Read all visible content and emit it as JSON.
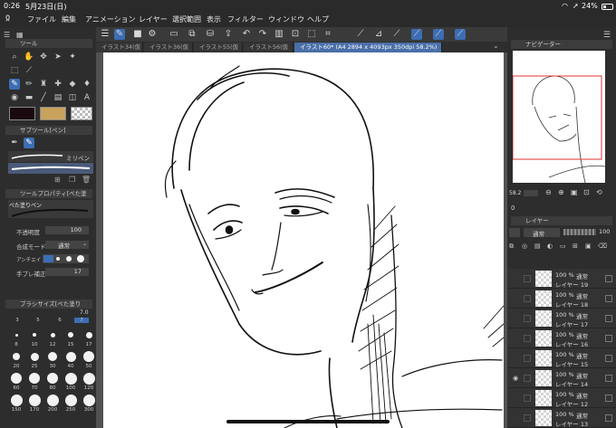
{
  "status": {
    "time": "0:26",
    "date": "5月23日(日)",
    "battery": "24%"
  },
  "menu": {
    "items": [
      "ファイル",
      "編集",
      "アニメーション",
      "レイヤー",
      "選択範囲",
      "表示",
      "フィルター",
      "ウィンドウ",
      "ヘルプ"
    ]
  },
  "tabs": [
    {
      "label": "イラスト34(仮"
    },
    {
      "label": "イラスト36(仮"
    },
    {
      "label": "イラスト55(仮"
    },
    {
      "label": "イラスト56(仮"
    },
    {
      "label": "イラスト60* (A4 2894 x 4093px 350dpi 58.2%)"
    }
  ],
  "left": {
    "tool_panel_title": "ツール",
    "subtool_panel_title": "サブツール[ペン]",
    "subtool_item": "ミリペン",
    "tool_property_title": "ツールプロパティ[べた塗",
    "brush_name": "べた塗りペン",
    "opacity_label": "不透明度",
    "opacity_value": "100",
    "blend_label": "合成モード",
    "blend_value": "通常",
    "antialias_label": "アンチエイ",
    "stabilize_label": "手ブレ補正",
    "stabilize_value": "17",
    "brushsize_panel_title": "ブラシサイズ[べた塗り",
    "brushsize_top": [
      "3",
      "5",
      "6",
      "7"
    ],
    "brushsize_current": "7.0",
    "brush_sizes": [
      "8",
      "10",
      "12",
      "15",
      "17",
      "20",
      "25",
      "30",
      "40",
      "50",
      "60",
      "70",
      "80",
      "100",
      "120",
      "150",
      "170",
      "200",
      "250",
      "300"
    ]
  },
  "right": {
    "navigator_title": "ナビゲーター",
    "zoom_value": "58.2",
    "layer_panel_title": "レイヤー",
    "layer_blend": "通常",
    "layer_opacity": "100",
    "layers": [
      {
        "opacity": "100 %",
        "mode": "通常",
        "name": "レイヤー 19"
      },
      {
        "opacity": "100 %",
        "mode": "通常",
        "name": "レイヤー 18"
      },
      {
        "opacity": "100 %",
        "mode": "通常",
        "name": "レイヤー 17"
      },
      {
        "opacity": "100 %",
        "mode": "通常",
        "name": "レイヤー 16"
      },
      {
        "opacity": "100 %",
        "mode": "通常",
        "name": "レイヤー 15"
      },
      {
        "opacity": "100 %",
        "mode": "通常",
        "name": "レイヤー 14"
      },
      {
        "opacity": "100 %",
        "mode": "通常",
        "name": "レイヤー 12"
      },
      {
        "opacity": "100 %",
        "mode": "通常",
        "name": "レイヤー 13"
      }
    ]
  },
  "colors": {
    "accent": "#3d6db3",
    "main_color": "#1a0a10",
    "sub_color": "#c9a35c"
  }
}
